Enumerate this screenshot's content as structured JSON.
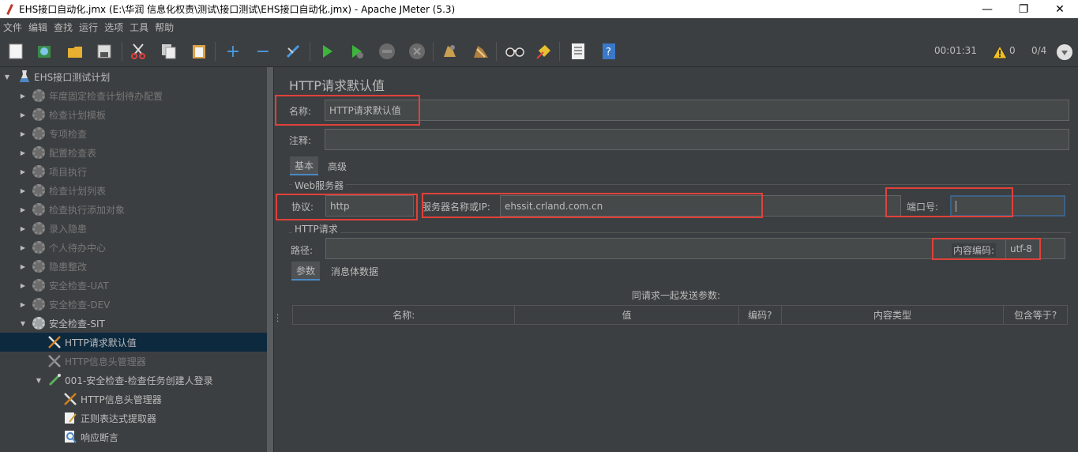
{
  "window": {
    "title": "EHS接口自动化.jmx (E:\\华润 信息化权责\\测试\\接口测试\\EHS接口自动化.jmx) - Apache JMeter (5.3)",
    "minimize": "—",
    "maximize": "❐",
    "close": "✕"
  },
  "menu": [
    "文件",
    "编辑",
    "查找",
    "运行",
    "选项",
    "工具",
    "帮助"
  ],
  "toolbar": {
    "timer": "00:01:31",
    "warnings": "0",
    "threads": "0/4"
  },
  "tree": {
    "root": "EHS接口测试计划",
    "items": [
      {
        "label": "年度固定检查计划待办配置",
        "disabled": true
      },
      {
        "label": "检查计划模板",
        "disabled": true
      },
      {
        "label": "专项检查",
        "disabled": true
      },
      {
        "label": "配置检查表",
        "disabled": true
      },
      {
        "label": "项目执行",
        "disabled": true
      },
      {
        "label": "检查计划列表",
        "disabled": true
      },
      {
        "label": "检查执行添加对象",
        "disabled": true
      },
      {
        "label": "录入隐患",
        "disabled": true
      },
      {
        "label": "个人待办中心",
        "disabled": true
      },
      {
        "label": "隐患整改",
        "disabled": true
      },
      {
        "label": "安全检查-UAT",
        "disabled": true
      },
      {
        "label": "安全检查-DEV",
        "disabled": true
      },
      {
        "label": "安全检查-SIT",
        "disabled": false
      }
    ],
    "children": {
      "http_defaults": "HTTP请求默认值",
      "header_manager": "HTTP信息头管理器",
      "sampler": "001-安全检查-检查任务创建人登录",
      "sampler_header": "HTTP信息头管理器",
      "regex": "正则表达式提取器",
      "assertion": "响应断言"
    }
  },
  "panel": {
    "heading": "HTTP请求默认值",
    "name_label": "名称:",
    "name_value": "HTTP请求默认值",
    "comment_label": "注释:",
    "comment_value": "",
    "tabs": [
      "基本",
      "高级"
    ],
    "web_server_group": "Web服务器",
    "protocol_label": "协议:",
    "protocol_value": "http",
    "server_label": "服务器名称或IP:",
    "server_value": "ehssit.crland.com.cn",
    "port_label": "端口号:",
    "port_value": "",
    "http_request_group": "HTTP请求",
    "path_label": "路径:",
    "path_value": "",
    "encoding_label": "内容编码:",
    "encoding_value": "utf-8",
    "subtabs": [
      "参数",
      "消息体数据"
    ],
    "params_caption": "同请求一起发送参数:",
    "columns": [
      "名称:",
      "值",
      "编码?",
      "内容类型",
      "包含等于?"
    ]
  }
}
